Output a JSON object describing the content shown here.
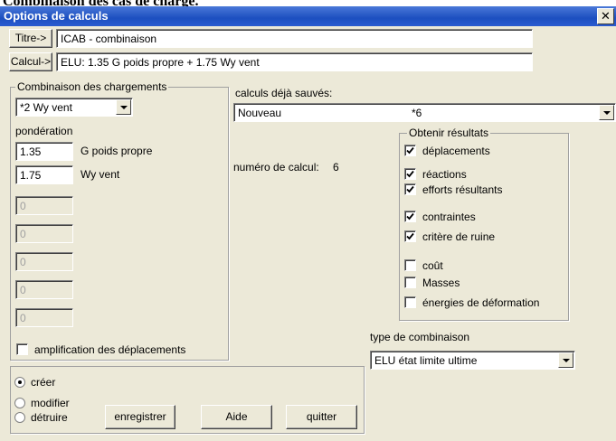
{
  "document": {
    "heading": "Combinaison des cas de charge."
  },
  "window": {
    "title": "Options de calculs",
    "close_glyph": "✕"
  },
  "titre": {
    "button_label": "Titre->",
    "value": "ICAB - combinaison"
  },
  "calcul": {
    "button_label": "Calcul->",
    "value": "ELU: 1.35 G poids propre + 1.75 Wy vent"
  },
  "combinaison": {
    "legend": "Combinaison des chargements",
    "selected": "*2 Wy vent",
    "ponderation_label": "pondération",
    "weights": [
      {
        "value": "1.35",
        "label": "G poids propre"
      },
      {
        "value": "1.75",
        "label": "Wy vent"
      },
      {
        "value": "0"
      },
      {
        "value": "0"
      },
      {
        "value": "0"
      },
      {
        "value": "0"
      },
      {
        "value": "0"
      }
    ],
    "amplification_label": "amplification des déplacements",
    "amplification_checked": false
  },
  "calculs_sauves": {
    "label": "calculs déjà sauvés:",
    "selected_name": "Nouveau",
    "selected_code": "*6"
  },
  "numero": {
    "label": "numéro de calcul:",
    "value": "6"
  },
  "resultats": {
    "legend": "Obtenir résultats",
    "items": [
      {
        "label": "déplacements",
        "checked": true
      },
      {
        "label": "réactions",
        "checked": true
      },
      {
        "label": "efforts résultants",
        "checked": true
      },
      {
        "label": "contraintes",
        "checked": true
      },
      {
        "label": "critère de ruine",
        "checked": true
      },
      {
        "label": "coût",
        "checked": false
      },
      {
        "label": "Masses",
        "checked": false
      },
      {
        "label": "énergies de déformation",
        "checked": false
      }
    ]
  },
  "type_combinaison": {
    "label": "type de combinaison",
    "selected": "ELU état limite ultime"
  },
  "actions": {
    "modes": [
      {
        "label": "créer",
        "selected": true
      },
      {
        "label": "modifier",
        "selected": false
      },
      {
        "label": "détruire",
        "selected": false
      }
    ],
    "enregistrer_label": "enregistrer",
    "aide_label": "Aide",
    "quitter_label": "quitter"
  }
}
